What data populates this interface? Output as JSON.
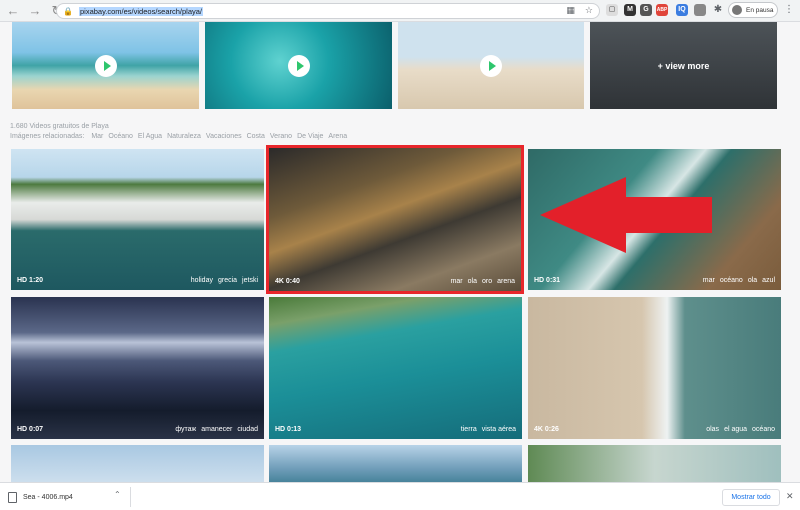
{
  "browser": {
    "url": "pixabay.com/es/videos/search/playa/",
    "profile_label": "En pausa",
    "extensions": [
      {
        "name": "ext-m",
        "text": "M",
        "color": "#333333"
      },
      {
        "name": "ext-g",
        "text": "G",
        "color": "#555555"
      },
      {
        "name": "ext-abp",
        "text": "ABP",
        "color": "#e0453a"
      },
      {
        "name": "ext-iq",
        "text": "IQ",
        "color": "#3b7de0"
      }
    ]
  },
  "top_row": {
    "view_more_label": "+ view more"
  },
  "results": {
    "count_text": "1.680 Videos gratuitos de Playa",
    "related_label": "Imágenes relacionadas:",
    "related_tags": [
      "Mar",
      "Océano",
      "El Agua",
      "Naturaleza",
      "Vacaciones",
      "Costa",
      "Verano",
      "De Viaje",
      "Arena"
    ]
  },
  "videos": [
    {
      "duration": "HD 1:20",
      "tags": [
        "holiday",
        "grecia",
        "jetski"
      ]
    },
    {
      "duration": "4K 0:40",
      "tags": [
        "mar",
        "ola",
        "oro",
        "arena"
      ]
    },
    {
      "duration": "HD 0:31",
      "tags": [
        "mar",
        "océano",
        "ola",
        "azul"
      ]
    },
    {
      "duration": "HD 0:07",
      "tags": [
        "футаж",
        "amanecer",
        "ciudad"
      ]
    },
    {
      "duration": "HD 0:13",
      "tags": [
        "tierra",
        "vista aérea"
      ]
    },
    {
      "duration": "4K 0:26",
      "tags": [
        "olas",
        "el agua",
        "océano"
      ]
    }
  ],
  "downloads": {
    "file_name": "Sea - 4006.mp4",
    "show_all_label": "Mostrar todo"
  }
}
